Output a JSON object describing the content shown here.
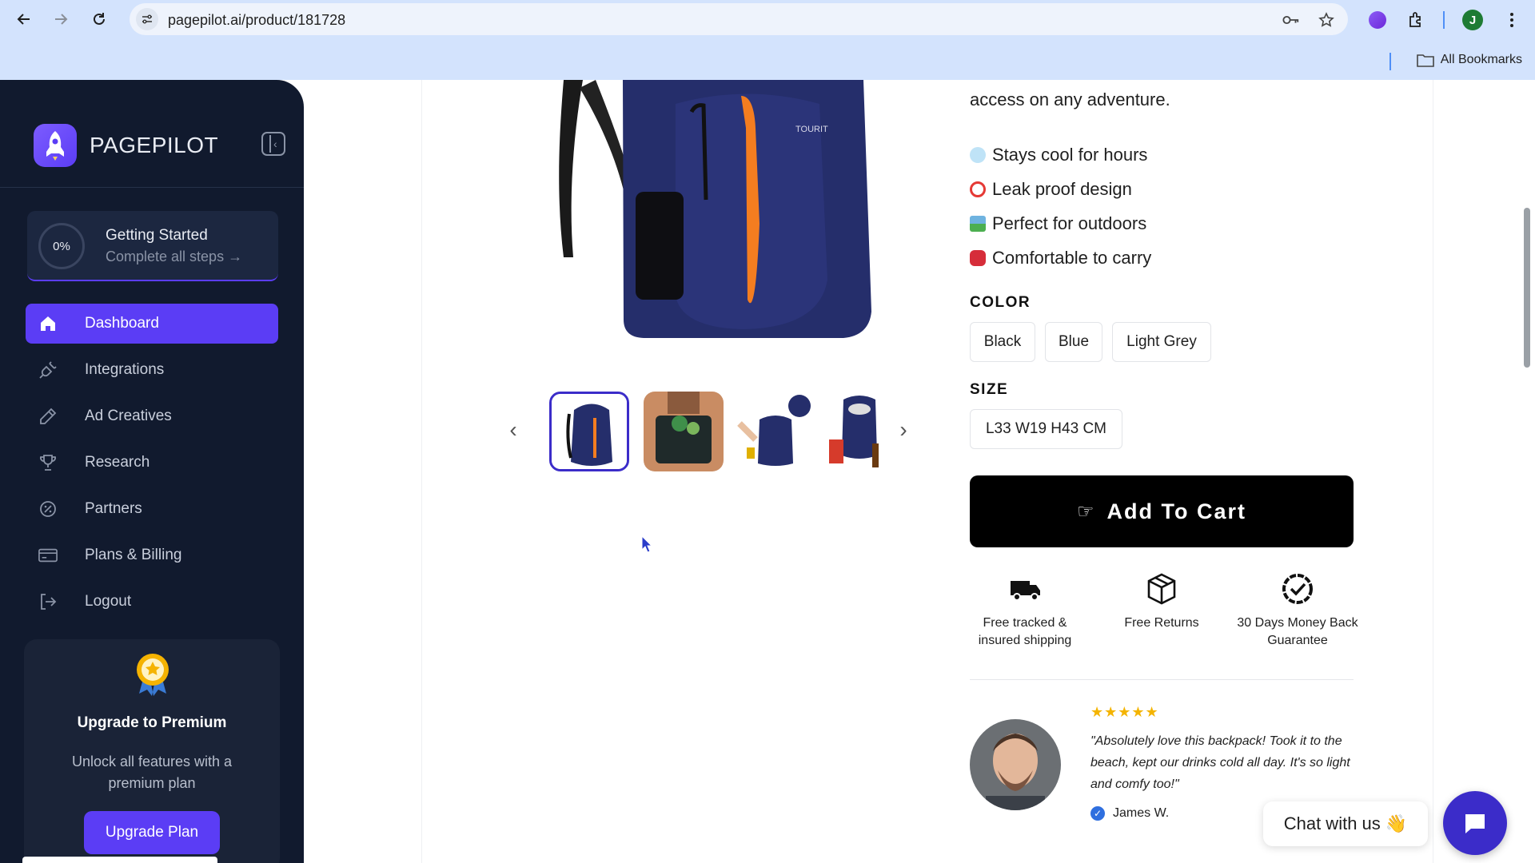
{
  "browser": {
    "url": "pagepilot.ai/product/181728",
    "profile_initial": "J",
    "bookmarks_label": "All Bookmarks"
  },
  "sidebar": {
    "brand": "PAGEPILOT",
    "getting_started": {
      "progress_label": "0%",
      "progress": 0,
      "title": "Getting Started",
      "subtitle": "Complete all steps →"
    },
    "items": [
      {
        "label": "Dashboard",
        "icon": "home-icon",
        "active": true
      },
      {
        "label": "Integrations",
        "icon": "plug-icon"
      },
      {
        "label": "Ad Creatives",
        "icon": "pencil-icon"
      },
      {
        "label": "Research",
        "icon": "trophy-icon"
      },
      {
        "label": "Partners",
        "icon": "badge-percent-icon"
      },
      {
        "label": "Plans & Billing",
        "icon": "credit-card-icon"
      },
      {
        "label": "Logout",
        "icon": "logout-icon"
      }
    ],
    "premium": {
      "title": "Upgrade to Premium",
      "description": "Unlock all features with a premium plan",
      "button": "Upgrade Plan"
    }
  },
  "product": {
    "description_tail": "access on any adventure.",
    "features": [
      {
        "icon": "snowflake-icon",
        "text": "Stays cool for hours"
      },
      {
        "icon": "no-entry-icon",
        "text": "Leak proof design"
      },
      {
        "icon": "landscape-icon",
        "text": "Perfect for outdoors"
      },
      {
        "icon": "backpack-icon",
        "text": "Comfortable to carry"
      }
    ],
    "color_label": "COLOR",
    "colors": [
      "Black",
      "Blue",
      "Light Grey"
    ],
    "size_label": "SIZE",
    "sizes": [
      "L33 W19 H43 CM"
    ],
    "cart_button": "Add To Cart",
    "perks": [
      {
        "icon": "truck-icon",
        "text": "Free tracked & insured shipping"
      },
      {
        "icon": "box-icon",
        "text": "Free Returns"
      },
      {
        "icon": "check-badge-icon",
        "text": "30 Days Money Back Guarantee"
      }
    ],
    "review": {
      "rating": 5,
      "stars": "★★★★★",
      "quote": "\"Absolutely love this backpack! Took it to the beach, kept our drinks cold all day. It's so light and comfy too!\"",
      "author": "James W."
    }
  },
  "chat": {
    "label": "Chat with us 👋"
  },
  "colors": {
    "sidebar_bg": "#111a2e",
    "accent": "#5b3df5",
    "cart_bg": "#000000",
    "star": "#f4b400"
  }
}
